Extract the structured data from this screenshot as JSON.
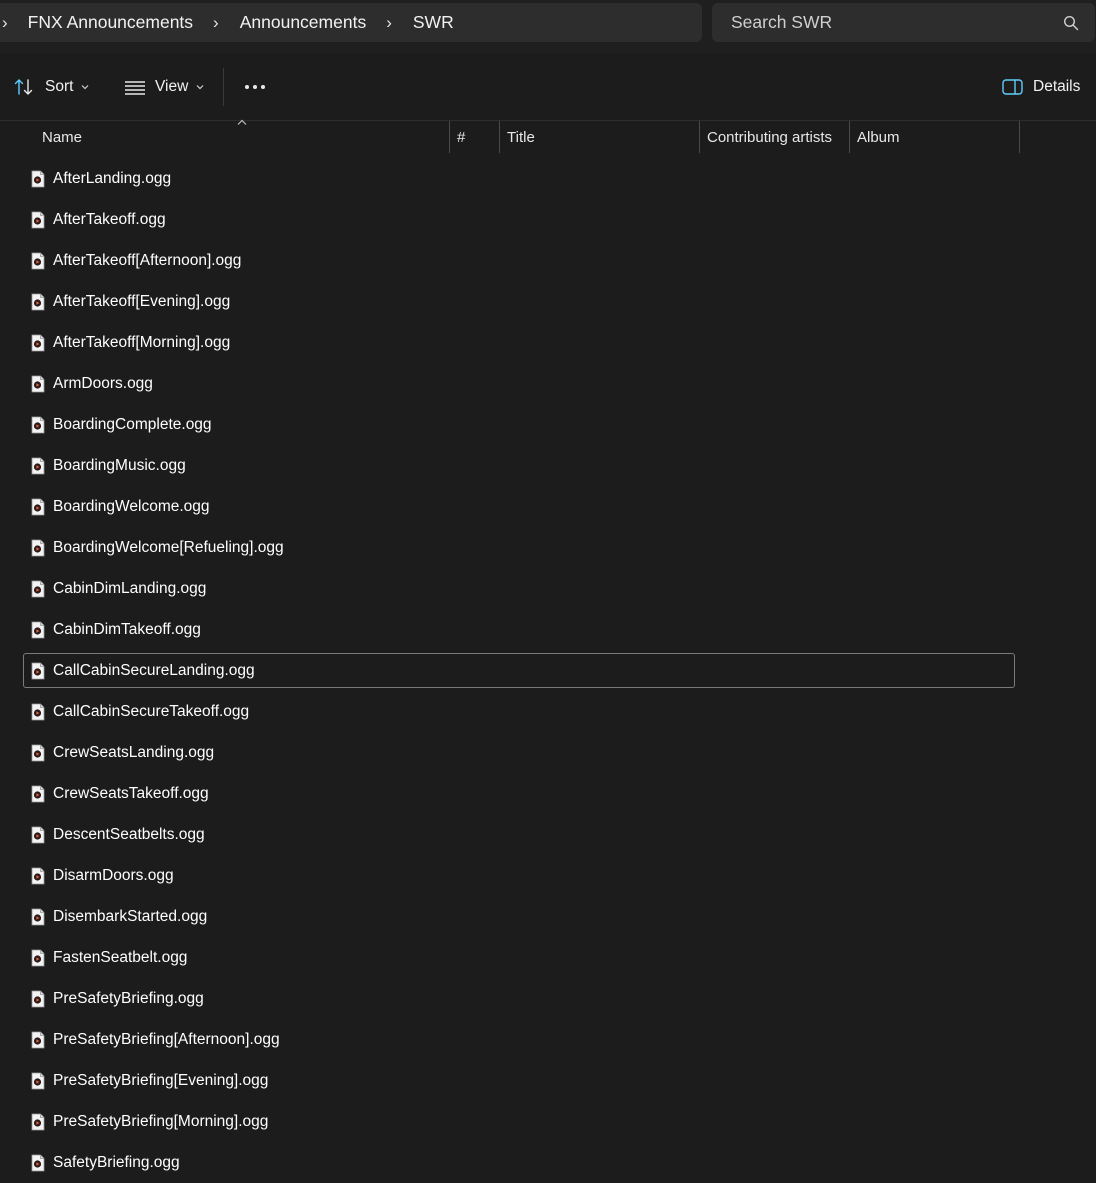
{
  "breadcrumb": {
    "items": [
      "FNX Announcements",
      "Announcements",
      "SWR"
    ]
  },
  "search": {
    "placeholder": "Search SWR"
  },
  "toolbar": {
    "sort_label": "Sort",
    "view_label": "View",
    "details_label": "Details"
  },
  "columns": {
    "name": "Name",
    "number": "#",
    "title": "Title",
    "artists": "Contributing artists",
    "album": "Album"
  },
  "files": [
    "AfterLanding.ogg",
    "AfterTakeoff.ogg",
    "AfterTakeoff[Afternoon].ogg",
    "AfterTakeoff[Evening].ogg",
    "AfterTakeoff[Morning].ogg",
    "ArmDoors.ogg",
    "BoardingComplete.ogg",
    "BoardingMusic.ogg",
    "BoardingWelcome.ogg",
    "BoardingWelcome[Refueling].ogg",
    "CabinDimLanding.ogg",
    "CabinDimTakeoff.ogg",
    "CallCabinSecureLanding.ogg",
    "CallCabinSecureTakeoff.ogg",
    "CrewSeatsLanding.ogg",
    "CrewSeatsTakeoff.ogg",
    "DescentSeatbelts.ogg",
    "DisarmDoors.ogg",
    "DisembarkStarted.ogg",
    "FastenSeatbelt.ogg",
    "PreSafetyBriefing.ogg",
    "PreSafetyBriefing[Afternoon].ogg",
    "PreSafetyBriefing[Evening].ogg",
    "PreSafetyBriefing[Morning].ogg",
    "SafetyBriefing.ogg"
  ],
  "icons": {
    "file": "audio-file-icon",
    "sort": "sort-arrows-icon",
    "view": "view-list-icon",
    "more": "more-options-icon",
    "details": "details-pane-icon",
    "search": "search-icon"
  },
  "colors": {
    "background": "#1c1c1c",
    "bar": "#2d2d2d",
    "accent": "#60cdff"
  }
}
